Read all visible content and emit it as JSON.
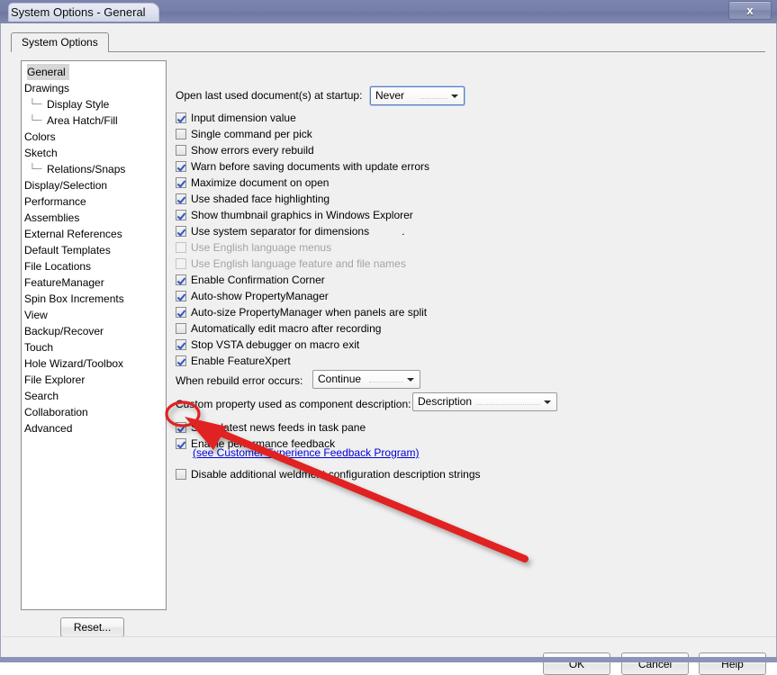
{
  "window": {
    "title": "System Options - General",
    "close_label": "x"
  },
  "tab": {
    "label": "System Options"
  },
  "sidebar": {
    "items": [
      {
        "label": "General",
        "level": 0,
        "selected": true
      },
      {
        "label": "Drawings",
        "level": 0,
        "selected": false
      },
      {
        "label": "Display Style",
        "level": 1,
        "selected": false
      },
      {
        "label": "Area Hatch/Fill",
        "level": 1,
        "selected": false
      },
      {
        "label": "Colors",
        "level": 0,
        "selected": false
      },
      {
        "label": "Sketch",
        "level": 0,
        "selected": false
      },
      {
        "label": "Relations/Snaps",
        "level": 1,
        "selected": false
      },
      {
        "label": "Display/Selection",
        "level": 0,
        "selected": false
      },
      {
        "label": "Performance",
        "level": 0,
        "selected": false
      },
      {
        "label": "Assemblies",
        "level": 0,
        "selected": false
      },
      {
        "label": "External References",
        "level": 0,
        "selected": false
      },
      {
        "label": "Default Templates",
        "level": 0,
        "selected": false
      },
      {
        "label": "File Locations",
        "level": 0,
        "selected": false
      },
      {
        "label": "FeatureManager",
        "level": 0,
        "selected": false
      },
      {
        "label": "Spin Box Increments",
        "level": 0,
        "selected": false
      },
      {
        "label": "View",
        "level": 0,
        "selected": false
      },
      {
        "label": "Backup/Recover",
        "level": 0,
        "selected": false
      },
      {
        "label": "Touch",
        "level": 0,
        "selected": false
      },
      {
        "label": "Hole Wizard/Toolbox",
        "level": 0,
        "selected": false
      },
      {
        "label": "File Explorer",
        "level": 0,
        "selected": false
      },
      {
        "label": "Search",
        "level": 0,
        "selected": false
      },
      {
        "label": "Collaboration",
        "level": 0,
        "selected": false
      },
      {
        "label": "Advanced",
        "level": 0,
        "selected": false
      }
    ],
    "reset_label": "Reset..."
  },
  "options": {
    "startup_label": "Open last used document(s) at startup:",
    "startup_value": "Never",
    "rebuild_error_label": "When rebuild error occurs:",
    "rebuild_error_value": "Continue",
    "custom_property_label": "Custom property used as component description:",
    "custom_property_value": "Description",
    "separator_hint": ".",
    "feedback_link": "(see Customer Experience Feedback Program)",
    "checkboxes": [
      {
        "label": "Input dimension value",
        "checked": true,
        "disabled": false
      },
      {
        "label": "Single command per pick",
        "checked": false,
        "disabled": false
      },
      {
        "label": "Show errors every rebuild",
        "checked": false,
        "disabled": false
      },
      {
        "label": "Warn before saving documents with update errors",
        "checked": true,
        "disabled": false
      },
      {
        "label": "Maximize document on open",
        "checked": true,
        "disabled": false
      },
      {
        "label": "Use shaded face highlighting",
        "checked": true,
        "disabled": false
      },
      {
        "label": "Show thumbnail graphics in Windows Explorer",
        "checked": true,
        "disabled": false
      },
      {
        "label": "Use system separator for dimensions",
        "checked": true,
        "disabled": false
      },
      {
        "label": "Use English language menus",
        "checked": false,
        "disabled": true
      },
      {
        "label": "Use English language feature and file names",
        "checked": false,
        "disabled": true
      },
      {
        "label": "Enable Confirmation Corner",
        "checked": true,
        "disabled": false
      },
      {
        "label": "Auto-show PropertyManager",
        "checked": true,
        "disabled": false
      },
      {
        "label": "Auto-size PropertyManager when panels are split",
        "checked": true,
        "disabled": false
      },
      {
        "label": "Automatically edit macro after recording",
        "checked": false,
        "disabled": false
      },
      {
        "label": "Stop VSTA debugger on macro exit",
        "checked": true,
        "disabled": false
      },
      {
        "label": "Enable FeatureXpert",
        "checked": true,
        "disabled": false
      }
    ],
    "checkboxes_lower": [
      {
        "label": "Show latest news feeds in task pane",
        "checked": true,
        "disabled": false
      },
      {
        "label": "Enable performance feedback",
        "checked": true,
        "disabled": false
      },
      {
        "label": "Disable additional weldment configuration description strings",
        "checked": false,
        "disabled": false
      }
    ]
  },
  "buttons": {
    "ok": "OK",
    "cancel": "Cancel",
    "help": "Help"
  },
  "annotation": {
    "highlight_color": "#e02020",
    "target": "enable-performance-feedback-checkbox"
  }
}
